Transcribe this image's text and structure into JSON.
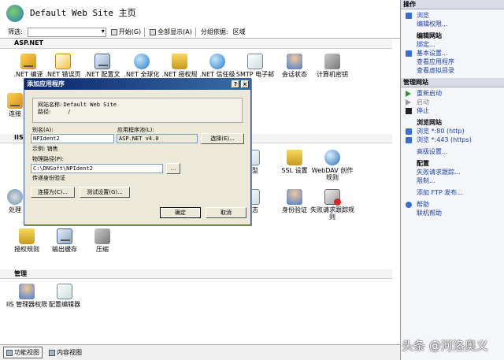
{
  "titlebar": {
    "title": "Default Web Site 主页"
  },
  "filterbar": {
    "label": "筛选:",
    "start": "开始(G)",
    "show_all": "全部显示(A)",
    "group_by": "分组依据:",
    "group_value": "区域"
  },
  "sections": {
    "aspnet": "ASP.NET",
    "iis": "IIS",
    "manage": "管理"
  },
  "tiles": {
    "r1": [
      ".NET 编译",
      ".NET 错误页",
      ".NET 配置文",
      ".NET 全球化",
      ".NET 授权规",
      ".NET 信任级",
      "SMTP 电子邮",
      "会话状态",
      "计算机密钥"
    ],
    "conn": "连接",
    "iis": [
      "类型",
      "SSL 设置",
      "WebDAV 创作规则"
    ],
    "r2": [
      "处理",
      "日志",
      "身份验证",
      "失败请求跟踪规则"
    ],
    "r3": [
      "授权规则",
      "输出缓存",
      "压缩"
    ],
    "mg": [
      "IIS 管理器权限",
      "配置编辑器"
    ]
  },
  "bottom": {
    "features": "功能视图",
    "content": "内容视图"
  },
  "actions": {
    "header": "操作",
    "explore": "浏览",
    "edit_perm": "编辑权限...",
    "edit_site": "编辑网站",
    "bind": "绑定...",
    "basic": "基本设置...",
    "view_apps": "查看应用程序",
    "view_vdirs": "查看虚拟目录",
    "manage_site": "管理网站",
    "restart": "重新启动",
    "start": "启动",
    "stop": "停止",
    "browse_site": "浏览网站",
    "browse80": "浏览 *:80 (http)",
    "browse443": "浏览 *:443 (https)",
    "advanced": "高级设置...",
    "config": "配置",
    "failed": "失败请求跟踪...",
    "limits": "限制...",
    "ftp": "添加 FTP 发布...",
    "help": "帮助",
    "online_help": "联机帮助"
  },
  "dialog": {
    "title": "添加应用程序",
    "site_label": "网站名称:",
    "site_value": "Default Web Site",
    "path_label": "路径:",
    "path_value": "/",
    "alias_label": "别名(A):",
    "alias_value": "NPIdent2",
    "pool_label": "应用程序池(L):",
    "pool_value": "ASP.NET v4.0",
    "select_btn": "选择(E)...",
    "example": "示例: 销售",
    "phys_label": "物理路径(P):",
    "phys_value": "C:\\DNSoft\\NPIdent2",
    "browse_btn": "...",
    "passthrough": "传递身份验证",
    "connect_btn": "连接为(C)...",
    "test_btn": "测试设置(G)...",
    "ok": "确定",
    "cancel": "取消"
  },
  "watermark": "头条 @河洛奥义"
}
